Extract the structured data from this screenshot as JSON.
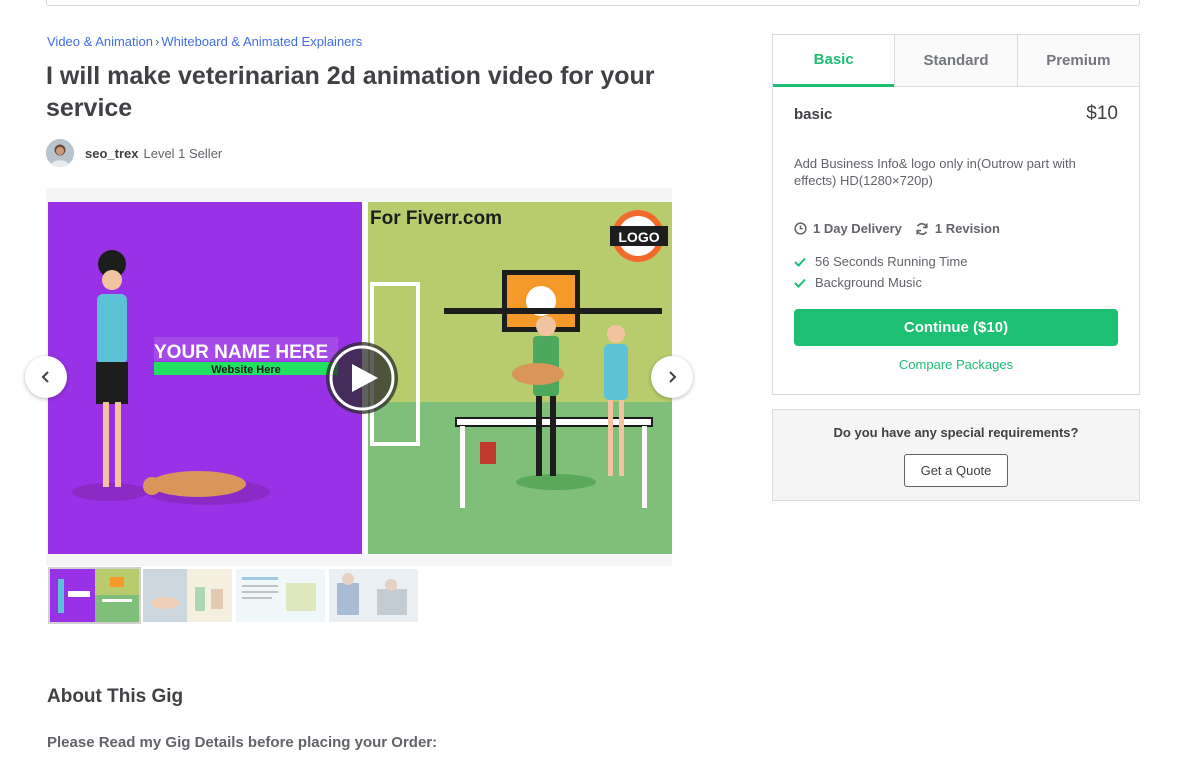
{
  "breadcrumb": {
    "category": "Video & Animation",
    "separator": "›",
    "subcategory": "Whiteboard & Animated Explainers"
  },
  "gig": {
    "title": "I will make veterinarian 2d animation video for your service"
  },
  "seller": {
    "username": "seo_trex",
    "level": "Level 1 Seller"
  },
  "gallery": {
    "banner_text": "For Fiverr.com",
    "logo_text": "LOGO",
    "name_text": "YOUR NAME HERE",
    "website_text": "Website Here",
    "play_icon": "play-icon",
    "prev_icon": "chevron-left-icon",
    "next_icon": "chevron-right-icon"
  },
  "about": {
    "title": "About This Gig",
    "intro": "Please Read my Gig Details before placing your Order:"
  },
  "packages": {
    "tabs": [
      {
        "label": "Basic",
        "active": true
      },
      {
        "label": "Standard",
        "active": false
      },
      {
        "label": "Premium",
        "active": false
      }
    ],
    "selected": {
      "name": "basic",
      "price": "$10",
      "description": "Add Business Info& logo only in(Outrow part with effects) HD(1280×720p)",
      "delivery": "1 Day Delivery",
      "revisions": "1 Revision",
      "features": [
        "56 Seconds Running Time",
        "Background Music"
      ]
    },
    "continue_label": "Continue ($10)",
    "compare_label": "Compare Packages"
  },
  "quote": {
    "question": "Do you have any special requirements?",
    "button_label": "Get a Quote"
  },
  "colors": {
    "accent": "#1dbf73",
    "link": "#446ee7",
    "text": "#404145",
    "muted": "#62646a"
  }
}
